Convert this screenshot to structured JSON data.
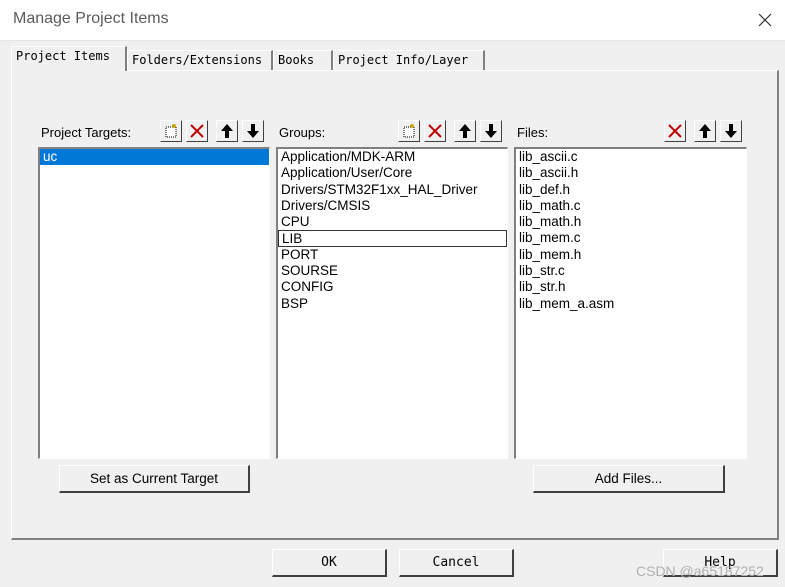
{
  "window": {
    "title": "Manage Project Items"
  },
  "tabs": [
    "Project Items",
    "Folders/Extensions",
    "Books",
    "Project Info/Layer"
  ],
  "targets": {
    "label": "Project Targets:",
    "items": [
      "uc"
    ]
  },
  "groups": {
    "label": "Groups:",
    "items": [
      "Application/MDK-ARM",
      "Application/User/Core",
      "Drivers/STM32F1xx_HAL_Driver",
      "Drivers/CMSIS",
      "CPU",
      "LIB",
      "PORT",
      "SOURSE",
      "CONFIG",
      "BSP"
    ]
  },
  "files": {
    "label": "Files:",
    "items": [
      "lib_ascii.c",
      "lib_ascii.h",
      "lib_def.h",
      "lib_math.c",
      "lib_math.h",
      "lib_mem.c",
      "lib_mem.h",
      "lib_str.c",
      "lib_str.h",
      "lib_mem_a.asm"
    ]
  },
  "buttons": {
    "set_target": "Set as Current Target",
    "add_files": "Add Files...",
    "ok": "OK",
    "cancel": "Cancel",
    "help": "Help"
  },
  "watermark": "CSDN @a65187252",
  "colors": {
    "selection": "#0078d7",
    "delete": "#c00000"
  }
}
